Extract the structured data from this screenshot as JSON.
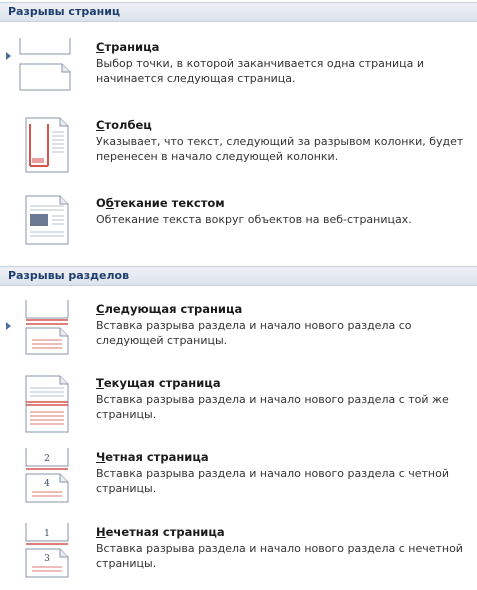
{
  "sections": {
    "page_breaks": "Разрывы страниц",
    "section_breaks": "Разрывы разделов"
  },
  "items": {
    "page": {
      "accel": "С",
      "title_rest": "траница",
      "desc": "Выбор точки, в которой заканчивается одна страница и начинается следующая страница.",
      "icon": "page-break-icon"
    },
    "column": {
      "accel": "С",
      "title_rest": "толбец",
      "desc": "Указывает, что текст, следующий за разрывом колонки, будет перенесен в начало следующей колонки.",
      "icon": "column-break-icon"
    },
    "text_wrapping": {
      "pre": "О",
      "accel": "б",
      "title_rest": "текание текстом",
      "desc": "Обтекание текста вокруг объектов на веб-страницах.",
      "icon": "text-wrapping-icon"
    },
    "next_page": {
      "accel": "С",
      "title_rest": "ледующая страница",
      "desc": "Вставка разрыва раздела и начало нового раздела со следующей страницы.",
      "icon": "next-page-icon"
    },
    "continuous": {
      "accel": "Т",
      "title_rest": "екущая страница",
      "desc": "Вставка разрыва раздела и начало нового раздела с той же страницы.",
      "icon": "continuous-icon"
    },
    "even_page": {
      "accel": "Ч",
      "title_rest": "етная страница",
      "desc": "Вставка разрыва раздела и начало нового раздела с четной страницы.",
      "icon": "even-page-icon",
      "page_numbers": [
        "2",
        "4"
      ]
    },
    "odd_page": {
      "accel": "Н",
      "title_rest": "ечетная страница",
      "desc": "Вставка разрыва раздела и начало нового раздела с нечетной страницы.",
      "icon": "odd-page-icon",
      "page_numbers": [
        "1",
        "3"
      ]
    }
  },
  "colors": {
    "accent_red": "#d9534f",
    "header_text": "#1e3f6e"
  }
}
